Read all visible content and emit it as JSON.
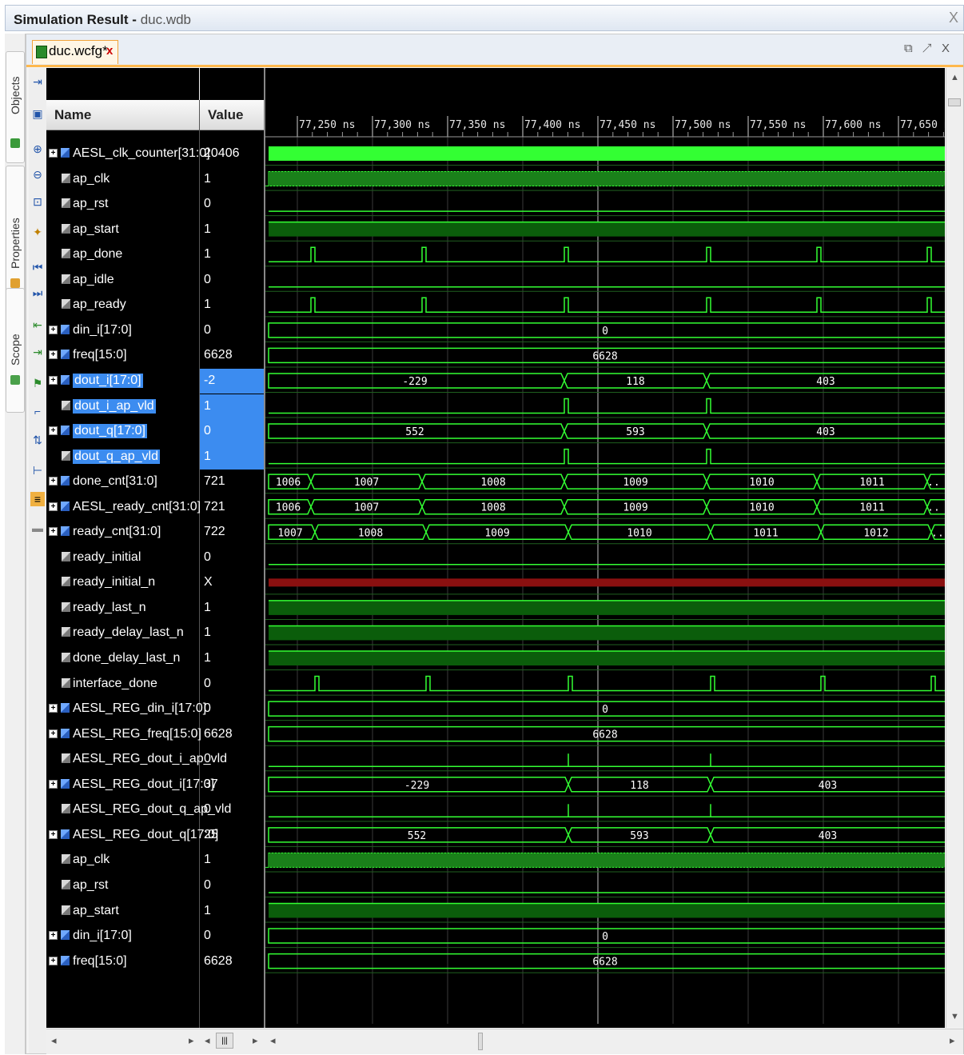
{
  "window": {
    "title": "Simulation Result",
    "subtitle": "duc.wdb",
    "close_glyph": "X"
  },
  "side_tabs": [
    {
      "label": "Objects",
      "icon": "objects-icon"
    },
    {
      "label": "Properties",
      "icon": "properties-icon"
    },
    {
      "label": "Scope",
      "icon": "scope-icon"
    }
  ],
  "file_tab": {
    "label": "duc.wcfg*",
    "close_glyph": "x",
    "icon": "waveform-config-icon"
  },
  "window_controls": "⧉ ↗ X",
  "columns": {
    "name": "Name",
    "value": "Value"
  },
  "colors": {
    "wave": "#33ff33",
    "bus_fill": "#33ff33",
    "high_fill": "#0b5d0b",
    "x_fill": "#8a1010",
    "cursor": "#ffffff",
    "selection": "#3c8cf0"
  },
  "timeline": {
    "tick_labels": [
      "77,250 ns",
      "77,300 ns",
      "77,350 ns",
      "77,400 ns",
      "77,450 ns",
      "77,500 ns",
      "77,550 ns",
      "77,600 ns",
      "77,650 ns"
    ],
    "cursor_label": ""
  },
  "signals": [
    {
      "name": "AESL_clk_counter[31:0]",
      "value": "20406",
      "kind": "bus",
      "expand": true,
      "wave": "fullbus",
      "selected": false
    },
    {
      "name": "ap_clk",
      "value": "1",
      "kind": "bit",
      "wave": "clock",
      "selected": false
    },
    {
      "name": "ap_rst",
      "value": "0",
      "kind": "bit",
      "wave": "low",
      "selected": false
    },
    {
      "name": "ap_start",
      "value": "1",
      "kind": "bit",
      "wave": "high",
      "selected": false
    },
    {
      "name": "ap_done",
      "value": "1",
      "kind": "bit",
      "wave": "pulse",
      "pulses": [
        57,
        196,
        374,
        552,
        690,
        828
      ],
      "selected": false
    },
    {
      "name": "ap_idle",
      "value": "0",
      "kind": "bit",
      "wave": "low",
      "selected": false
    },
    {
      "name": "ap_ready",
      "value": "1",
      "kind": "bit",
      "wave": "pulse",
      "pulses": [
        57,
        196,
        374,
        552,
        690,
        828
      ],
      "selected": false
    },
    {
      "name": "din_i[17:0]",
      "value": "0",
      "kind": "bus",
      "expand": true,
      "wave": "bus",
      "segs": [
        {
          "t": "0",
          "a": 0,
          "b": 850
        }
      ],
      "selected": false
    },
    {
      "name": "freq[15:0]",
      "value": "6628",
      "kind": "bus",
      "expand": true,
      "wave": "bus",
      "segs": [
        {
          "t": "6628",
          "a": 0,
          "b": 850
        }
      ],
      "selected": false
    },
    {
      "name": "dout_i[17:0]",
      "value": "-2",
      "kind": "bus",
      "expand": true,
      "wave": "bus",
      "segs": [
        {
          "t": "-229",
          "a": 0,
          "b": 374
        },
        {
          "t": "118",
          "a": 374,
          "b": 552
        },
        {
          "t": "403",
          "a": 552,
          "b": 850
        }
      ],
      "selected": true
    },
    {
      "name": "dout_i_ap_vld",
      "value": "1",
      "kind": "bit",
      "wave": "pulse",
      "pulses": [
        374,
        552
      ],
      "selected": true
    },
    {
      "name": "dout_q[17:0]",
      "value": "0",
      "kind": "bus",
      "expand": true,
      "wave": "bus",
      "segs": [
        {
          "t": "552",
          "a": 0,
          "b": 374
        },
        {
          "t": "593",
          "a": 374,
          "b": 552
        },
        {
          "t": "403",
          "a": 552,
          "b": 850
        }
      ],
      "selected": true
    },
    {
      "name": "dout_q_ap_vld",
      "value": "1",
      "kind": "bit",
      "wave": "pulse",
      "pulses": [
        374,
        552
      ],
      "selected": true
    },
    {
      "name": "done_cnt[31:0]",
      "value": "721",
      "kind": "bus",
      "expand": true,
      "wave": "bus",
      "segs": [
        {
          "t": "1006",
          "a": 0,
          "b": 57
        },
        {
          "t": "1007",
          "a": 57,
          "b": 196
        },
        {
          "t": "1008",
          "a": 196,
          "b": 374
        },
        {
          "t": "1009",
          "a": 374,
          "b": 552
        },
        {
          "t": "1010",
          "a": 552,
          "b": 690
        },
        {
          "t": "1011",
          "a": 690,
          "b": 828
        },
        {
          "t": "..",
          "a": 828,
          "b": 850
        }
      ],
      "selected": false
    },
    {
      "name": "AESL_ready_cnt[31:0]",
      "value": "721",
      "kind": "bus",
      "expand": true,
      "wave": "bus",
      "segs": [
        {
          "t": "1006",
          "a": 0,
          "b": 57
        },
        {
          "t": "1007",
          "a": 57,
          "b": 196
        },
        {
          "t": "1008",
          "a": 196,
          "b": 374
        },
        {
          "t": "1009",
          "a": 374,
          "b": 552
        },
        {
          "t": "1010",
          "a": 552,
          "b": 690
        },
        {
          "t": "1011",
          "a": 690,
          "b": 828
        },
        {
          "t": "..",
          "a": 828,
          "b": 850
        }
      ],
      "selected": false
    },
    {
      "name": "ready_cnt[31:0]",
      "value": "722",
      "kind": "bus",
      "expand": true,
      "wave": "bus",
      "segs": [
        {
          "t": "1007",
          "a": 0,
          "b": 62
        },
        {
          "t": "1008",
          "a": 62,
          "b": 201
        },
        {
          "t": "1009",
          "a": 201,
          "b": 379
        },
        {
          "t": "1010",
          "a": 379,
          "b": 557
        },
        {
          "t": "1011",
          "a": 557,
          "b": 695
        },
        {
          "t": "1012",
          "a": 695,
          "b": 833
        },
        {
          "t": "..",
          "a": 833,
          "b": 850
        }
      ],
      "selected": false
    },
    {
      "name": "ready_initial",
      "value": "0",
      "kind": "bit",
      "wave": "low",
      "selected": false
    },
    {
      "name": "ready_initial_n",
      "value": "X",
      "kind": "bit",
      "wave": "xval",
      "selected": false
    },
    {
      "name": "ready_last_n",
      "value": "1",
      "kind": "bit",
      "wave": "high",
      "selected": false
    },
    {
      "name": "ready_delay_last_n",
      "value": "1",
      "kind": "bit",
      "wave": "high",
      "selected": false
    },
    {
      "name": "done_delay_last_n",
      "value": "1",
      "kind": "bit",
      "wave": "high",
      "selected": false
    },
    {
      "name": "interface_done",
      "value": "0",
      "kind": "bit",
      "wave": "pulse",
      "pulses": [
        62,
        201,
        379,
        557,
        695,
        833
      ],
      "selected": false
    },
    {
      "name": "AESL_REG_din_i[17:0]",
      "value": "0",
      "kind": "bus",
      "expand": true,
      "wave": "bus",
      "segs": [
        {
          "t": "0",
          "a": 0,
          "b": 850
        }
      ],
      "selected": false
    },
    {
      "name": "AESL_REG_freq[15:0]",
      "value": "6628",
      "kind": "bus",
      "expand": true,
      "wave": "bus",
      "segs": [
        {
          "t": "6628",
          "a": 0,
          "b": 850
        }
      ],
      "selected": false
    },
    {
      "name": "AESL_REG_dout_i_ap_vld",
      "value": "0",
      "kind": "bit",
      "wave": "spike",
      "pulses": [
        379,
        557
      ],
      "selected": false
    },
    {
      "name": "AESL_REG_dout_i[17:0]",
      "value": "37",
      "kind": "bus",
      "expand": true,
      "wave": "bus",
      "segs": [
        {
          "t": "-229",
          "a": 0,
          "b": 379
        },
        {
          "t": "118",
          "a": 379,
          "b": 557
        },
        {
          "t": "403",
          "a": 557,
          "b": 850
        }
      ],
      "selected": false
    },
    {
      "name": "AESL_REG_dout_q_ap_vld",
      "value": "0",
      "kind": "bit",
      "wave": "spike",
      "pulses": [
        379,
        557
      ],
      "selected": false
    },
    {
      "name": "AESL_REG_dout_q[17:0]",
      "value": "25",
      "kind": "bus",
      "expand": true,
      "wave": "bus",
      "segs": [
        {
          "t": "552",
          "a": 0,
          "b": 379
        },
        {
          "t": "593",
          "a": 379,
          "b": 557
        },
        {
          "t": "403",
          "a": 557,
          "b": 850
        }
      ],
      "selected": false
    },
    {
      "name": "ap_clk",
      "value": "1",
      "kind": "bit",
      "wave": "clock",
      "selected": false
    },
    {
      "name": "ap_rst",
      "value": "0",
      "kind": "bit",
      "wave": "low",
      "selected": false
    },
    {
      "name": "ap_start",
      "value": "1",
      "kind": "bit",
      "wave": "high",
      "selected": false
    },
    {
      "name": "din_i[17:0]",
      "value": "0",
      "kind": "bus",
      "expand": true,
      "wave": "bus",
      "segs": [
        {
          "t": "0",
          "a": 0,
          "b": 850
        }
      ],
      "selected": false
    },
    {
      "name": "freq[15:0]",
      "value": "6628",
      "kind": "bus",
      "expand": true,
      "wave": "bus",
      "segs": [
        {
          "t": "6628",
          "a": 0,
          "b": 850
        }
      ],
      "selected": false
    }
  ]
}
